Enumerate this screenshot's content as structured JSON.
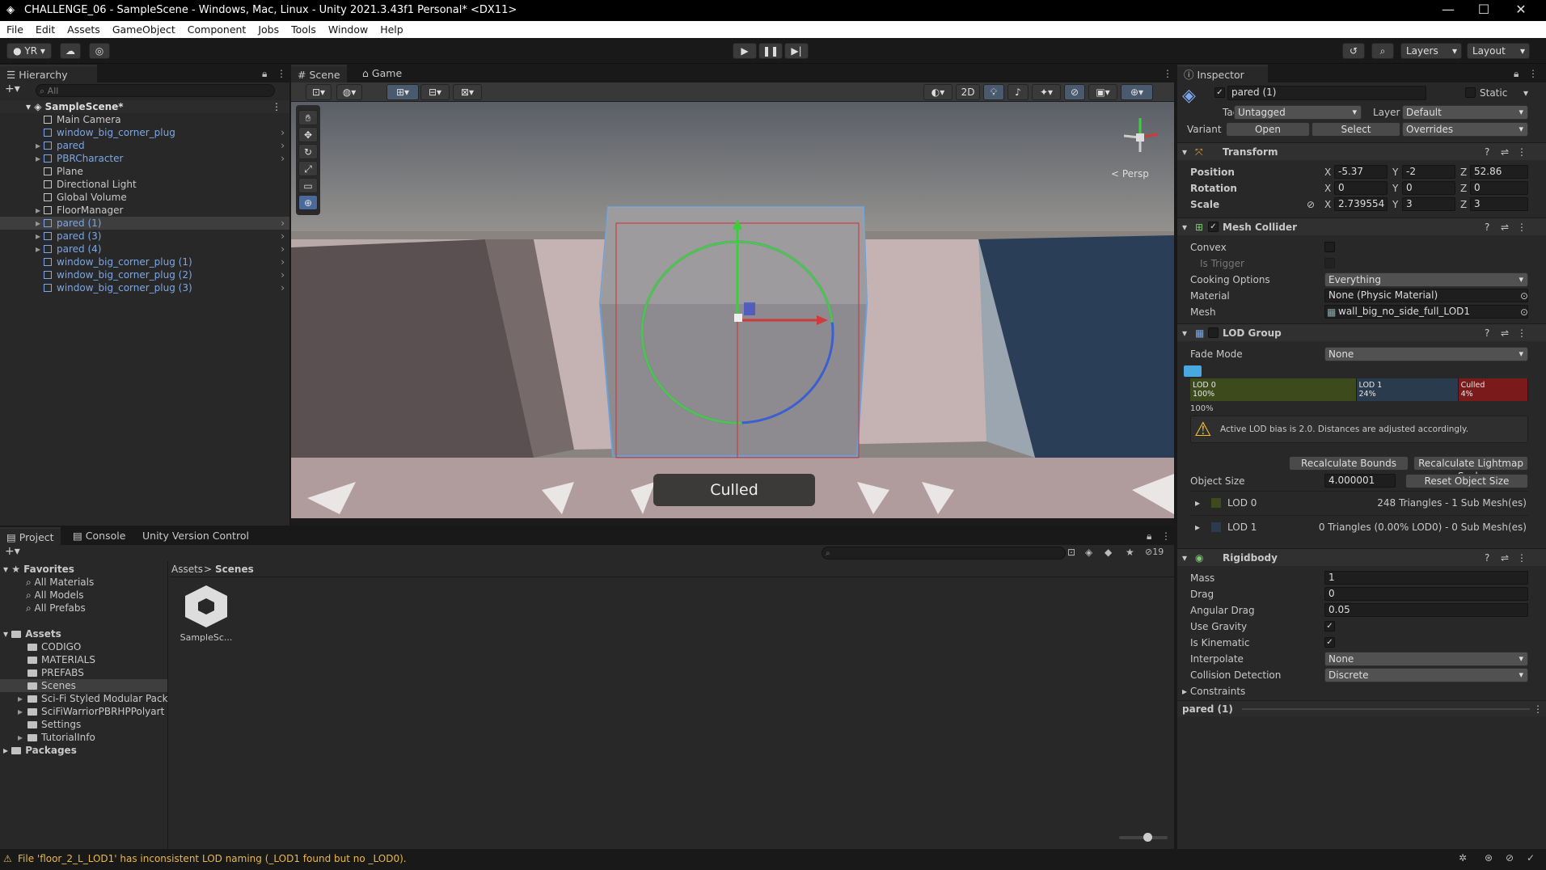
{
  "window": {
    "title": "CHALLENGE_06 - SampleScene - Windows, Mac, Linux - Unity 2021.3.43f1 Personal* <DX11>"
  },
  "menu": [
    "File",
    "Edit",
    "Assets",
    "GameObject",
    "Component",
    "Jobs",
    "Tools",
    "Window",
    "Help"
  ],
  "toolbar": {
    "account": "YR",
    "layers": "Layers",
    "layout": "Layout"
  },
  "hierarchy": {
    "tab": "Hierarchy",
    "search_placeholder": "All",
    "scene": "SampleScene*",
    "items": [
      {
        "label": "Main Camera",
        "prefab": false,
        "expand": false
      },
      {
        "label": "window_big_corner_plug",
        "prefab": true,
        "expand": false
      },
      {
        "label": "pared",
        "prefab": true,
        "expand": true
      },
      {
        "label": "PBRCharacter",
        "prefab": true,
        "expand": true
      },
      {
        "label": "Plane",
        "prefab": false,
        "expand": false
      },
      {
        "label": "Directional Light",
        "prefab": false,
        "expand": false
      },
      {
        "label": "Global Volume",
        "prefab": false,
        "expand": false
      },
      {
        "label": "FloorManager",
        "prefab": false,
        "expand": true
      },
      {
        "label": "pared (1)",
        "prefab": true,
        "expand": true,
        "selected": true
      },
      {
        "label": "pared (3)",
        "prefab": true,
        "expand": true
      },
      {
        "label": "pared (4)",
        "prefab": true,
        "expand": true
      },
      {
        "label": "window_big_corner_plug (1)",
        "prefab": true,
        "expand": false
      },
      {
        "label": "window_big_corner_plug (2)",
        "prefab": true,
        "expand": false
      },
      {
        "label": "window_big_corner_plug (3)",
        "prefab": true,
        "expand": false
      }
    ]
  },
  "scene_view": {
    "tabs": [
      "Scene",
      "Game"
    ],
    "mode_2d": "2D",
    "persp": "< Persp",
    "culled_label": "Culled"
  },
  "project": {
    "tabs": [
      "Project",
      "Console",
      "Unity Version Control"
    ],
    "count": "19",
    "favorites_label": "Favorites",
    "favorites": [
      "All Materials",
      "All Models",
      "All Prefabs"
    ],
    "assets_label": "Assets",
    "assets": [
      "CODIGO",
      "MATERIALS",
      "PREFABS",
      "Scenes",
      "Sci-Fi Styled Modular Pack",
      "SciFiWarriorPBRHPPolyart",
      "Settings",
      "TutorialInfo"
    ],
    "packages_label": "Packages",
    "breadcrumb": [
      "Assets",
      "Scenes"
    ],
    "files": [
      {
        "name": "SampleSc..."
      }
    ]
  },
  "status": {
    "message": "File 'floor_2_L_LOD1' has inconsistent LOD naming (_LOD1 found but no _LOD0)."
  },
  "inspector": {
    "tab": "Inspector",
    "object_name": "pared (1)",
    "static_label": "Static",
    "tag_label": "Tag",
    "tag_value": "Untagged",
    "layer_label": "Layer",
    "layer_value": "Default",
    "variant_label": "Variant",
    "open_label": "Open",
    "select_label": "Select",
    "overrides_label": "Overrides",
    "transform": {
      "title": "Transform",
      "position_label": "Position",
      "rotation_label": "Rotation",
      "scale_label": "Scale",
      "position": {
        "x": "-5.37",
        "y": "-2",
        "z": "52.86"
      },
      "rotation": {
        "x": "0",
        "y": "0",
        "z": "0"
      },
      "scale": {
        "x": "2.739554",
        "y": "3",
        "z": "3"
      }
    },
    "mesh_collider": {
      "title": "Mesh Collider",
      "convex_label": "Convex",
      "is_trigger_label": "Is Trigger",
      "cooking_label": "Cooking Options",
      "cooking_value": "Everything",
      "material_label": "Material",
      "material_value": "None (Physic Material)",
      "mesh_label": "Mesh",
      "mesh_value": "wall_big_no_side_full_LOD1"
    },
    "lod_group": {
      "title": "LOD Group",
      "fade_label": "Fade Mode",
      "fade_value": "None",
      "bars": [
        {
          "name": "LOD 0",
          "pct": "100%",
          "share": 0.5,
          "color": "#3d4a1c"
        },
        {
          "name": "LOD 1",
          "pct": "24%",
          "share": 0.3,
          "color": "#2a3b4d"
        },
        {
          "name": "Culled",
          "pct": "4%",
          "share": 0.2,
          "color": "#7a1a1a"
        }
      ],
      "camera_pct": "100%",
      "warning": "Active LOD bias is 2.0. Distances are adjusted accordingly.",
      "recalc_bounds": "Recalculate Bounds",
      "recalc_lightmap": "Recalculate Lightmap Scale",
      "object_size_label": "Object Size",
      "object_size_value": "4.000001",
      "reset_size": "Reset Object Size",
      "lod0_label": "LOD 0",
      "lod0_info": "248 Triangles   - 1 Sub Mesh(es)",
      "lod1_label": "LOD 1",
      "lod1_info": "0 Triangles (0.00% LOD0) - 0 Sub Mesh(es)"
    },
    "rigidbody": {
      "title": "Rigidbody",
      "mass_label": "Mass",
      "mass": "1",
      "drag_label": "Drag",
      "drag": "0",
      "ang_drag_label": "Angular Drag",
      "ang_drag": "0.05",
      "gravity_label": "Use Gravity",
      "kinematic_label": "Is Kinematic",
      "interp_label": "Interpolate",
      "interp_value": "None",
      "collision_label": "Collision Detection",
      "collision_value": "Discrete",
      "constraints_label": "Constraints"
    },
    "footer_name": "pared (1)"
  },
  "axes": {
    "x": "X",
    "y": "Y",
    "z": "Z"
  }
}
